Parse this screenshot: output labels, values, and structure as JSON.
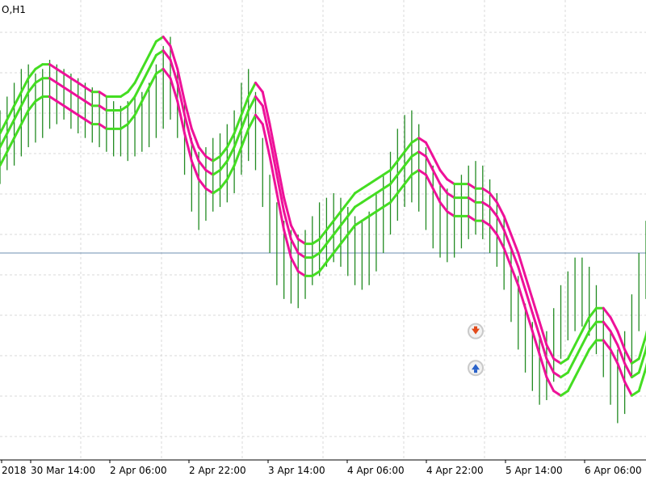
{
  "chart_window": {
    "symbol_label": "O,H1",
    "colors": {
      "background": "#ffffff",
      "grid": "#d8d8d8",
      "bars": "#228b22",
      "horizontal_line": "#6c8fb0",
      "band_up": "#44dd22",
      "band_down": "#ee1199",
      "sell_arrow": "#e24a1a",
      "buy_arrow": "#2a62c9",
      "arrow_ring": "#c9c9c9"
    },
    "icons": [
      "sell-arrow-icon",
      "buy-arrow-icon"
    ]
  },
  "chart_data": {
    "type": "line",
    "timeframe": "H1",
    "title": "",
    "xlabel": "",
    "ylabel": "",
    "grid": true,
    "price_axis_visible": false,
    "x_tick_labels": [
      "2018",
      "30 Mar 14:00",
      "2 Apr 06:00",
      "2 Apr 22:00",
      "3 Apr 14:00",
      "4 Apr 06:00",
      "4 Apr 22:00",
      "5 Apr 14:00",
      "6 Apr 06:00"
    ],
    "ylim": [
      0,
      100
    ],
    "horizontal_line_level": 45,
    "bar_style": "ohlc-bars",
    "bars_hl": [
      [
        60,
        76
      ],
      [
        63,
        79
      ],
      [
        64,
        82
      ],
      [
        66,
        85
      ],
      [
        68,
        86
      ],
      [
        69,
        84
      ],
      [
        70,
        85
      ],
      [
        72,
        87
      ],
      [
        73,
        86
      ],
      [
        74,
        85
      ],
      [
        72,
        84
      ],
      [
        71,
        83
      ],
      [
        70,
        82
      ],
      [
        69,
        81
      ],
      [
        68,
        80
      ],
      [
        67,
        79
      ],
      [
        66,
        78
      ],
      [
        66,
        77
      ],
      [
        65,
        78
      ],
      [
        66,
        79
      ],
      [
        67,
        80
      ],
      [
        68,
        82
      ],
      [
        70,
        86
      ],
      [
        72,
        90
      ],
      [
        74,
        92
      ],
      [
        70,
        85
      ],
      [
        62,
        78
      ],
      [
        54,
        70
      ],
      [
        50,
        67
      ],
      [
        52,
        68
      ],
      [
        54,
        70
      ],
      [
        55,
        71
      ],
      [
        56,
        73
      ],
      [
        58,
        76
      ],
      [
        62,
        82
      ],
      [
        65,
        85
      ],
      [
        63,
        80
      ],
      [
        55,
        70
      ],
      [
        45,
        62
      ],
      [
        38,
        56
      ],
      [
        35,
        52
      ],
      [
        34,
        50
      ],
      [
        33,
        49
      ],
      [
        35,
        50
      ],
      [
        38,
        53
      ],
      [
        40,
        56
      ],
      [
        42,
        57
      ],
      [
        43,
        58
      ],
      [
        42,
        57
      ],
      [
        40,
        55
      ],
      [
        38,
        53
      ],
      [
        37,
        52
      ],
      [
        38,
        54
      ],
      [
        41,
        58
      ],
      [
        45,
        62
      ],
      [
        49,
        67
      ],
      [
        52,
        72
      ],
      [
        55,
        75
      ],
      [
        56,
        76
      ],
      [
        54,
        73
      ],
      [
        50,
        68
      ],
      [
        46,
        64
      ],
      [
        44,
        60
      ],
      [
        43,
        59
      ],
      [
        44,
        60
      ],
      [
        46,
        62
      ],
      [
        48,
        64
      ],
      [
        49,
        65
      ],
      [
        48,
        64
      ],
      [
        45,
        61
      ],
      [
        42,
        58
      ],
      [
        37,
        53
      ],
      [
        30,
        46
      ],
      [
        24,
        40
      ],
      [
        19,
        34
      ],
      [
        15,
        30
      ],
      [
        12,
        27
      ],
      [
        13,
        28
      ],
      [
        17,
        33
      ],
      [
        22,
        38
      ],
      [
        26,
        41
      ],
      [
        28,
        44
      ],
      [
        29,
        44
      ],
      [
        27,
        42
      ],
      [
        23,
        38
      ],
      [
        18,
        33
      ],
      [
        12,
        28
      ],
      [
        8,
        24
      ],
      [
        10,
        28
      ],
      [
        18,
        36
      ],
      [
        28,
        45
      ],
      [
        35,
        52
      ]
    ],
    "series": [
      {
        "name": "",
        "color": "#ee1199",
        "role": "upper band",
        "values": [
          71,
          74,
          77,
          80,
          83,
          85,
          86,
          86,
          85,
          84,
          83,
          82,
          81,
          80,
          80,
          79,
          79,
          79,
          80,
          82,
          85,
          88,
          91,
          92,
          90,
          85,
          78,
          72,
          68,
          66,
          65,
          66,
          68,
          71,
          75,
          79,
          82,
          80,
          73,
          65,
          57,
          51,
          48,
          47,
          47,
          48,
          50,
          52,
          54,
          56,
          58,
          59,
          60,
          61,
          62,
          63,
          65,
          67,
          69,
          70,
          69,
          66,
          63,
          61,
          60,
          60,
          60,
          59,
          59,
          58,
          56,
          53,
          49,
          45,
          40,
          35,
          30,
          25,
          22,
          21,
          22,
          25,
          28,
          31,
          33,
          33,
          31,
          28,
          24,
          21,
          22,
          27,
          34,
          42
        ]
      },
      {
        "name": "",
        "color": "#ee1199",
        "role": "middle band",
        "values": [
          68,
          71,
          74,
          77,
          80,
          82,
          83,
          83,
          82,
          81,
          80,
          79,
          78,
          77,
          77,
          76,
          76,
          76,
          77,
          79,
          82,
          85,
          88,
          89,
          87,
          82,
          75,
          69,
          65,
          63,
          62,
          63,
          65,
          68,
          72,
          76,
          79,
          77,
          70,
          62,
          54,
          48,
          45,
          44,
          44,
          45,
          47,
          49,
          51,
          53,
          55,
          56,
          57,
          58,
          59,
          60,
          62,
          64,
          66,
          67,
          66,
          63,
          60,
          58,
          57,
          57,
          57,
          56,
          56,
          55,
          53,
          50,
          46,
          42,
          37,
          32,
          27,
          22,
          19,
          18,
          19,
          22,
          25,
          28,
          30,
          30,
          28,
          25,
          21,
          18,
          19,
          24,
          31,
          39
        ]
      },
      {
        "name": "",
        "color": "#44dd22",
        "role": "lower band",
        "values": [
          64,
          67,
          70,
          73,
          76,
          78,
          79,
          79,
          78,
          77,
          76,
          75,
          74,
          73,
          73,
          72,
          72,
          72,
          73,
          75,
          78,
          81,
          84,
          85,
          83,
          78,
          71,
          65,
          61,
          59,
          58,
          59,
          61,
          64,
          68,
          72,
          75,
          73,
          66,
          58,
          50,
          44,
          41,
          40,
          40,
          41,
          43,
          45,
          47,
          49,
          51,
          52,
          53,
          54,
          55,
          56,
          58,
          60,
          62,
          63,
          62,
          59,
          56,
          54,
          53,
          53,
          53,
          52,
          52,
          51,
          49,
          46,
          42,
          38,
          33,
          28,
          23,
          18,
          15,
          14,
          15,
          18,
          21,
          24,
          26,
          26,
          24,
          21,
          17,
          14,
          15,
          20,
          27,
          35
        ]
      }
    ],
    "annotations": [
      {
        "type": "sell-arrow",
        "bar_index": 67,
        "value": 28
      },
      {
        "type": "buy-arrow",
        "bar_index": 67,
        "value": 20
      }
    ]
  }
}
